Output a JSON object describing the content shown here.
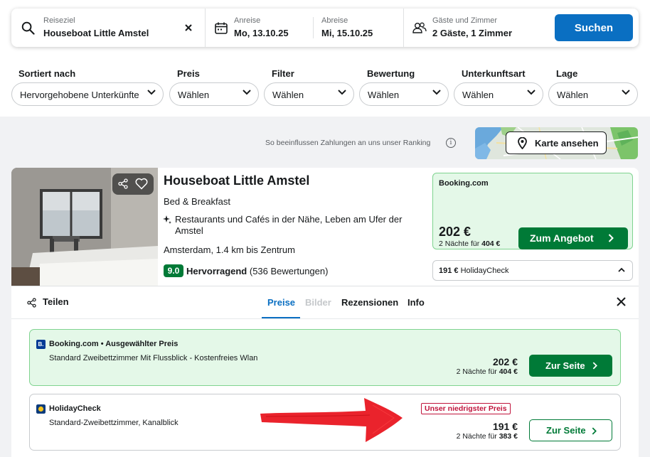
{
  "search": {
    "destination_label": "Reiseziel",
    "destination_value": "Houseboat Little Amstel",
    "checkin_label": "Anreise",
    "checkin_value": "Mo, 13.10.25",
    "checkout_label": "Abreise",
    "checkout_value": "Mi, 15.10.25",
    "guests_label": "Gäste und Zimmer",
    "guests_value": "2 Gäste, 1 Zimmer",
    "search_button": "Suchen"
  },
  "filters": [
    {
      "title": "Sortiert nach",
      "value": "Hervorgehobene Unterkünfte"
    },
    {
      "title": "Preis",
      "value": "Wählen"
    },
    {
      "title": "Filter",
      "value": "Wählen"
    },
    {
      "title": "Bewertung",
      "value": "Wählen"
    },
    {
      "title": "Unterkunftsart",
      "value": "Wählen"
    },
    {
      "title": "Lage",
      "value": "Wählen"
    }
  ],
  "ranking_note": "So beeinflussen Zahlungen an uns unser Ranking",
  "ranking_info_glyph": "i",
  "map_button": "Karte ansehen",
  "hotel": {
    "name": "Houseboat Little Amstel",
    "type": "Bed & Breakfast",
    "feature": "Restaurants und Cafés in der Nähe, Leben am Ufer der Amstel",
    "location": "Amsterdam, 1.4 km bis Zentrum",
    "rating_score": "9.0",
    "rating_word": "Hervorragend",
    "rating_count": "(536 Bewertungen)"
  },
  "top_offer": {
    "provider": "Booking.com",
    "price": "202 €",
    "nights_prefix": "2 Nächte für",
    "nights_total": "404 €",
    "button": "Zum Angebot"
  },
  "alt_offer": {
    "price": "191 €",
    "provider": "HolidayCheck"
  },
  "panel": {
    "share": "Teilen",
    "tabs": [
      "Preise",
      "Bilder",
      "Rezensionen",
      "Info"
    ]
  },
  "deals": [
    {
      "provider": "Booking.com • Ausgewählter Preis",
      "room": "Standard Zweibettzimmer Mit Flussblick - Kostenfreies Wlan",
      "price": "202 €",
      "nights_prefix": "2 Nächte für",
      "nights_total": "404 €",
      "button": "Zur Seite",
      "logo_glyph": "B."
    },
    {
      "provider": "HolidayCheck",
      "room": "Standard-Zweibettzimmer, Kanalblick",
      "price": "191 €",
      "nights_prefix": "2 Nächte für",
      "nights_total": "383 €",
      "button": "Zur Seite",
      "badge": "Unser niedrigster Preis"
    }
  ],
  "colors": {
    "primary_blue": "#0a6fc2",
    "deal_green": "#007a37",
    "offer_bg": "#e4f8e8",
    "lowest_red": "#c0143c",
    "annotation_red": "#e8101a"
  },
  "icons": [
    "search-icon",
    "clear-icon",
    "calendar-icon",
    "guests-icon",
    "chevron-down-icon",
    "info-icon",
    "map-pin-icon",
    "share-icon",
    "heart-icon",
    "sparkle-icon",
    "chevron-up-icon",
    "chevron-right-icon",
    "close-icon"
  ]
}
